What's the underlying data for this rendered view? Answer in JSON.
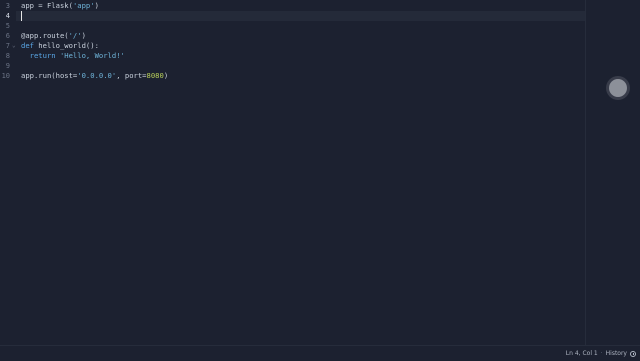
{
  "editor": {
    "lines": [
      {
        "num": "3",
        "tokens": [
          {
            "t": "app = Flask(",
            "c": ""
          },
          {
            "t": "'app'",
            "c": "str"
          },
          {
            "t": ")",
            "c": ""
          }
        ]
      },
      {
        "num": "4",
        "tokens": []
      },
      {
        "num": "5",
        "tokens": []
      },
      {
        "num": "6",
        "tokens": [
          {
            "t": "@app.route(",
            "c": "dec"
          },
          {
            "t": "'/'",
            "c": "str"
          },
          {
            "t": ")",
            "c": ""
          }
        ]
      },
      {
        "num": "7",
        "tokens": [
          {
            "t": "def",
            "c": "kw"
          },
          {
            "t": " hello_world():",
            "c": ""
          }
        ]
      },
      {
        "num": "8",
        "tokens": [
          {
            "t": "  ",
            "c": ""
          },
          {
            "t": "return",
            "c": "kw"
          },
          {
            "t": " ",
            "c": ""
          },
          {
            "t": "'Hello, World!'",
            "c": "str"
          }
        ]
      },
      {
        "num": "9",
        "tokens": []
      },
      {
        "num": "10",
        "tokens": [
          {
            "t": "app.run(host=",
            "c": ""
          },
          {
            "t": "'0.0.0.0'",
            "c": "str"
          },
          {
            "t": ", port=",
            "c": ""
          },
          {
            "t": "8080",
            "c": "num"
          },
          {
            "t": ")",
            "c": ""
          }
        ]
      }
    ],
    "line_numbers_shown": [
      "3",
      "4",
      "5",
      "6",
      "7",
      "8",
      "9",
      "10"
    ],
    "active_line": "4",
    "fold_marker": "⌄"
  },
  "statusbar": {
    "position": "Ln 4, Col 1",
    "separator": "·",
    "history_label": "History"
  },
  "colors": {
    "background": "#1c2130",
    "keyword": "#5aa7e6",
    "string": "#6fb4d9",
    "number": "#b8cf5a"
  }
}
